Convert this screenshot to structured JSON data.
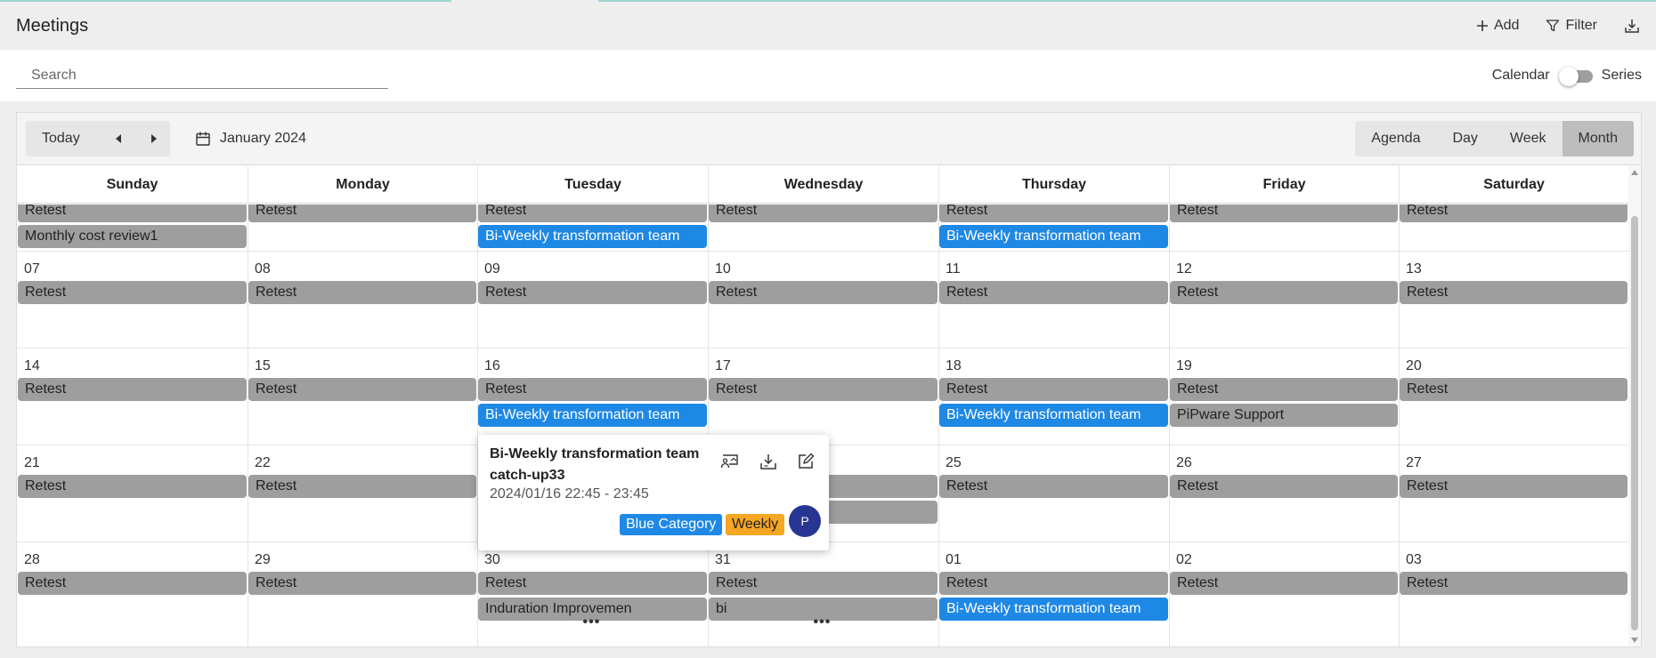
{
  "header": {
    "title": "Meetings",
    "add_label": "Add",
    "filter_label": "Filter"
  },
  "search": {
    "placeholder": "Search"
  },
  "view_toggle": {
    "left_label": "Calendar",
    "right_label": "Series",
    "state": "Calendar"
  },
  "calendar_toolbar": {
    "today_label": "Today",
    "current_period": "January 2024",
    "views": [
      "Agenda",
      "Day",
      "Week",
      "Month"
    ],
    "active_view": "Month"
  },
  "weekdays": [
    "Sunday",
    "Monday",
    "Tuesday",
    "Wednesday",
    "Thursday",
    "Friday",
    "Saturday"
  ],
  "weeks": [
    {
      "partial": true,
      "days": [
        {
          "date": "",
          "events": [
            {
              "title": "Retest",
              "color": "gray"
            },
            {
              "title": "Monthly cost review1",
              "color": "gray"
            }
          ]
        },
        {
          "date": "",
          "events": [
            {
              "title": "Retest",
              "color": "gray"
            }
          ]
        },
        {
          "date": "",
          "events": [
            {
              "title": "Retest",
              "color": "gray"
            },
            {
              "title": "Bi-Weekly transformation team",
              "color": "blue"
            }
          ]
        },
        {
          "date": "",
          "events": [
            {
              "title": "Retest",
              "color": "gray"
            }
          ]
        },
        {
          "date": "",
          "events": [
            {
              "title": "Retest",
              "color": "gray"
            },
            {
              "title": "Bi-Weekly transformation team",
              "color": "blue"
            }
          ]
        },
        {
          "date": "",
          "events": [
            {
              "title": "Retest",
              "color": "gray"
            }
          ]
        },
        {
          "date": "",
          "events": [
            {
              "title": "Retest",
              "color": "gray"
            }
          ]
        }
      ]
    },
    {
      "days": [
        {
          "date": "07",
          "events": [
            {
              "title": "Retest",
              "color": "gray"
            }
          ]
        },
        {
          "date": "08",
          "events": [
            {
              "title": "Retest",
              "color": "gray"
            }
          ]
        },
        {
          "date": "09",
          "events": [
            {
              "title": "Retest",
              "color": "gray"
            }
          ]
        },
        {
          "date": "10",
          "events": [
            {
              "title": "Retest",
              "color": "gray"
            }
          ]
        },
        {
          "date": "11",
          "events": [
            {
              "title": "Retest",
              "color": "gray"
            }
          ]
        },
        {
          "date": "12",
          "events": [
            {
              "title": "Retest",
              "color": "gray"
            }
          ]
        },
        {
          "date": "13",
          "events": [
            {
              "title": "Retest",
              "color": "gray"
            }
          ]
        }
      ]
    },
    {
      "days": [
        {
          "date": "14",
          "events": [
            {
              "title": "Retest",
              "color": "gray"
            }
          ]
        },
        {
          "date": "15",
          "events": [
            {
              "title": "Retest",
              "color": "gray"
            }
          ]
        },
        {
          "date": "16",
          "events": [
            {
              "title": "Retest",
              "color": "gray"
            },
            {
              "title": "Bi-Weekly transformation team",
              "color": "blue"
            }
          ]
        },
        {
          "date": "17",
          "events": [
            {
              "title": "Retest",
              "color": "gray"
            }
          ]
        },
        {
          "date": "18",
          "events": [
            {
              "title": "Retest",
              "color": "gray"
            },
            {
              "title": "Bi-Weekly transformation team",
              "color": "blue"
            }
          ]
        },
        {
          "date": "19",
          "events": [
            {
              "title": "Retest",
              "color": "gray"
            },
            {
              "title": "PiPware Support",
              "color": "gray"
            }
          ]
        },
        {
          "date": "20",
          "events": [
            {
              "title": "Retest",
              "color": "gray"
            }
          ]
        }
      ]
    },
    {
      "days": [
        {
          "date": "21",
          "events": [
            {
              "title": "Retest",
              "color": "gray"
            }
          ]
        },
        {
          "date": "22",
          "events": [
            {
              "title": "Retest",
              "color": "gray"
            }
          ]
        },
        {
          "date": "",
          "events": []
        },
        {
          "date": "",
          "events": [
            {
              "title": "",
              "color": "gray"
            },
            {
              "title": "",
              "color": "gray"
            }
          ]
        },
        {
          "date": "25",
          "events": [
            {
              "title": "Retest",
              "color": "gray"
            }
          ]
        },
        {
          "date": "26",
          "events": [
            {
              "title": "Retest",
              "color": "gray"
            }
          ]
        },
        {
          "date": "27",
          "events": [
            {
              "title": "Retest",
              "color": "gray"
            }
          ]
        }
      ]
    },
    {
      "days": [
        {
          "date": "28",
          "events": [
            {
              "title": "Retest",
              "color": "gray"
            }
          ]
        },
        {
          "date": "29",
          "events": [
            {
              "title": "Retest",
              "color": "gray"
            }
          ]
        },
        {
          "date": "30",
          "events": [
            {
              "title": "Retest",
              "color": "gray"
            },
            {
              "title": "Induration Improvemen",
              "color": "gray"
            }
          ],
          "more": "•••"
        },
        {
          "date": "31",
          "events": [
            {
              "title": "Retest",
              "color": "gray"
            },
            {
              "title": "bi",
              "color": "gray"
            }
          ],
          "more": "•••"
        },
        {
          "date": "01",
          "events": [
            {
              "title": "Retest",
              "color": "gray"
            },
            {
              "title": "Bi-Weekly transformation team",
              "color": "blue"
            }
          ]
        },
        {
          "date": "02",
          "events": [
            {
              "title": "Retest",
              "color": "gray"
            }
          ]
        },
        {
          "date": "03",
          "events": [
            {
              "title": "Retest",
              "color": "gray"
            }
          ]
        }
      ]
    }
  ],
  "popup": {
    "title": "Bi-Weekly transformation team catch-up33",
    "time": "2024/01/16 22:45 - 23:45",
    "category": "Blue Category",
    "recurrence": "Weekly",
    "avatar_initial": "P",
    "icons": [
      "presentation-icon",
      "download-icon",
      "edit-icon"
    ]
  },
  "colors": {
    "gray_event": "#9e9e9e",
    "blue_event": "#1e88e5",
    "weekly_tag": "#f5a623",
    "avatar": "#283593"
  }
}
